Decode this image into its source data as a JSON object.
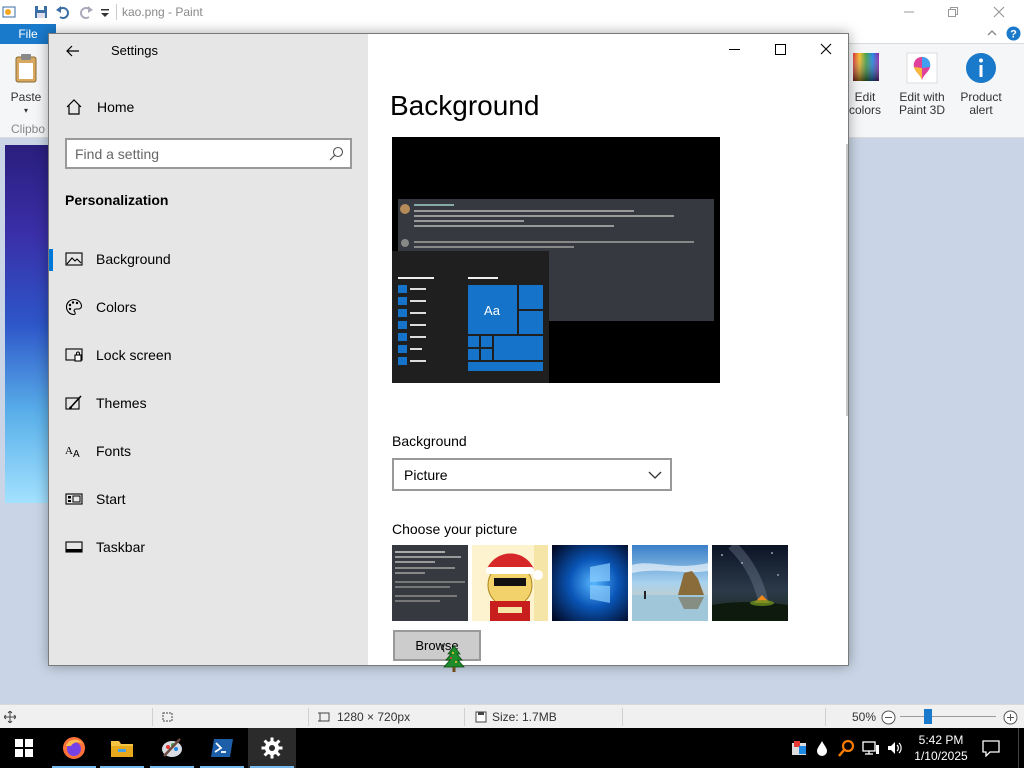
{
  "paint": {
    "title": "kao.png - Paint",
    "file_tab": "File",
    "ribbon": {
      "paste": "Paste",
      "clipboard_group": "Clipbo",
      "edit_colors_line1": "Edit",
      "edit_colors_line2": "colors",
      "edit_paint3d_line1": "Edit with",
      "edit_paint3d_line2": "Paint 3D",
      "product_alert_line1": "Product",
      "product_alert_line2": "alert"
    },
    "status": {
      "dimensions": "1280 × 720px",
      "size": "Size: 1.7MB",
      "zoom": "50%"
    }
  },
  "settings": {
    "window_title": "Settings",
    "home": "Home",
    "search_placeholder": "Find a setting",
    "section": "Personalization",
    "nav": [
      {
        "label": "Background",
        "icon": "picture-icon",
        "active": true
      },
      {
        "label": "Colors",
        "icon": "palette-icon",
        "active": false
      },
      {
        "label": "Lock screen",
        "icon": "lock-screen-icon",
        "active": false
      },
      {
        "label": "Themes",
        "icon": "brush-icon",
        "active": false
      },
      {
        "label": "Fonts",
        "icon": "font-icon",
        "active": false
      },
      {
        "label": "Start",
        "icon": "start-tiles-icon",
        "active": false
      },
      {
        "label": "Taskbar",
        "icon": "taskbar-icon",
        "active": false
      }
    ],
    "page_title": "Background",
    "preview_tile_text": "Aa",
    "background_label": "Background",
    "background_value": "Picture",
    "choose_label": "Choose your picture",
    "browse_label": "Browse"
  },
  "taskbar": {
    "time": "5:42 PM",
    "date": "1/10/2025",
    "apps": [
      "firefox-icon",
      "file-explorer-icon",
      "paint-icon",
      "powershell-icon",
      "settings-gear-icon"
    ]
  },
  "colors": {
    "accent": "#0078d7",
    "file_tab": "#1979ca",
    "nav_bg": "#e6e6e6"
  }
}
